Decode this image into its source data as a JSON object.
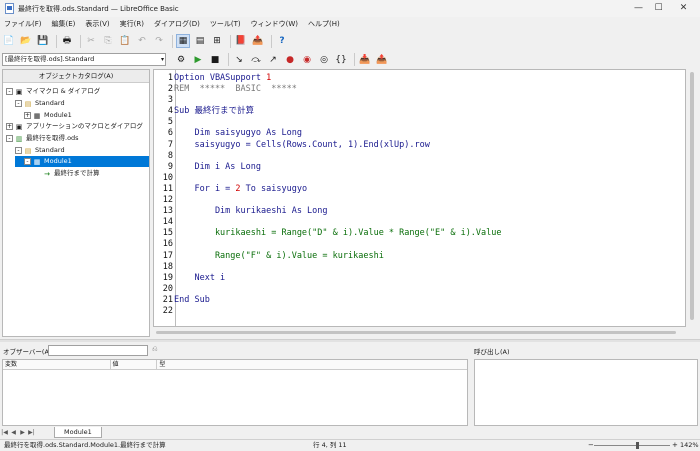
{
  "window": {
    "title": "最終行を取得.ods.Standard — LibreOffice Basic",
    "minimize_icon": "—",
    "maximize_icon": "☐",
    "close_icon": "✕"
  },
  "menu": [
    "ファイル(F)",
    "編集(E)",
    "表示(V)",
    "実行(R)",
    "ダイアログ(D)",
    "ツール(T)",
    "ウィンドウ(W)",
    "ヘルプ(H)"
  ],
  "toolbar": {
    "library_select": "[最終行を取得.ods].Standard",
    "dropdown_glyph": "▾"
  },
  "catalog": {
    "header": "オブジェクトカタログ(A)",
    "items": [
      {
        "label": "マイマクロ & ダイアログ",
        "expander": "-",
        "icon": "▣"
      },
      {
        "label": "Standard",
        "expander": "-",
        "icon": "▤"
      },
      {
        "label": "Module1",
        "expander": "+",
        "icon": "▦"
      },
      {
        "label": "アプリケーションのマクロとダイアログ",
        "expander": "+",
        "icon": "▣"
      },
      {
        "label": "最終行を取得.ods",
        "expander": "-",
        "icon": "▥"
      },
      {
        "label": "Standard",
        "expander": "-",
        "icon": "▤"
      },
      {
        "label": "Module1",
        "expander": "-",
        "icon": "▦"
      },
      {
        "label": "最終行まで計算",
        "expander": "",
        "icon": "→"
      }
    ]
  },
  "editor": {
    "line_numbers": [
      "1",
      "2",
      "3",
      "4",
      "5",
      "6",
      "7",
      "8",
      "9",
      "10",
      "11",
      "12",
      "13",
      "14",
      "15",
      "16",
      "17",
      "18",
      "19",
      "20",
      "21",
      "22"
    ],
    "lines": {
      "l1a": "Option VBASupport ",
      "l1b": "1",
      "l2": "REM  *****  BASIC  *****",
      "l4": "Sub 最終行まで計算",
      "l6": "    Dim saisyugyo As Long",
      "l7": "    saisyugyo = Cells(Rows.Count, 1).End(xlUp).row",
      "l9": "    Dim i As Long",
      "l11a": "    For i = ",
      "l11b": "2",
      "l11c": " To saisyugyo",
      "l13": "        Dim kurikaeshi As Long",
      "l15": "        kurikaeshi = Range(\"D\" & i).Value * Range(\"E\" & i).Value",
      "l17": "        Range(\"F\" & i).Value = kurikaeshi",
      "l19": "    Next i",
      "l21": "End Sub"
    }
  },
  "watch": {
    "label": "オブザーバー(A):",
    "input_value": "",
    "remove_icon": "⎌",
    "columns": [
      "変数",
      "値",
      "型"
    ]
  },
  "callstack": {
    "label": "呼び出し(A)"
  },
  "tabs": {
    "nav_first": "|◀",
    "nav_prev": "◀",
    "nav_next": "▶",
    "nav_last": "▶|",
    "active": "Module1"
  },
  "status": {
    "path": "最終行を取得.ods.Standard.Module1.最終行まで計算",
    "position": "行 4, 列 11",
    "zoom_minus": "−",
    "zoom_plus": "+",
    "zoom": "142%"
  },
  "icons": {
    "new": "📄",
    "open": "📂",
    "save": "💾",
    "print": "🖶",
    "cut": "✂",
    "copy": "⎘",
    "paste": "📋",
    "undo": "↶",
    "redo": "↷",
    "catalog": "▦",
    "libraries": "▤",
    "module": "⊞",
    "insert": "📕",
    "export": "📤",
    "help": "?",
    "compile": "⚙",
    "run": "▶",
    "stop": "■",
    "step_into": "↘",
    "step_over": "⤼",
    "step_out": "↗",
    "breakpoint": "●",
    "manage_bp": "◉",
    "watch": "◎",
    "find_parens": "{}",
    "insert_source": "📥",
    "save_source": "📤"
  }
}
